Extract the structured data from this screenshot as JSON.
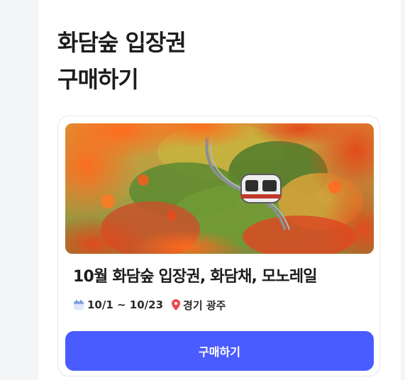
{
  "page": {
    "title_line1": "화담숲 입장권",
    "title_line2": "구매하기"
  },
  "product": {
    "name": "10월 화담숲 입장권, 화담채, 모노레일",
    "date_range": "10/1 ~ 10/23",
    "location": "경기 광주",
    "image_icon": "photo-autumn-monorail",
    "date_icon": "calendar-icon",
    "location_icon": "map-pin-icon"
  },
  "actions": {
    "buy_label": "구매하기"
  },
  "colors": {
    "accent": "#4a5cff",
    "pin": "#f0454a",
    "calendar": "#8aa6e8"
  }
}
